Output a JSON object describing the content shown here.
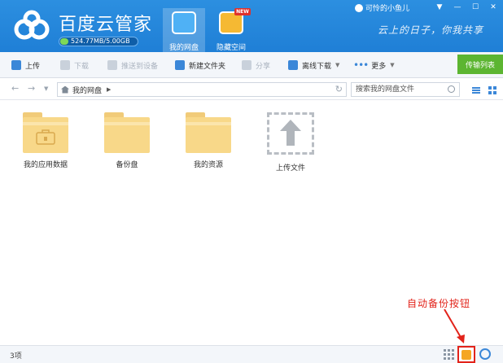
{
  "app": {
    "title": "百度云管家",
    "quota": "524.77MB/5.00GB",
    "user": "可怜的小鱼儿",
    "slogan": "云上的日子，你我共享"
  },
  "nav_tabs": [
    {
      "label": "我的网盘",
      "icon": "cloud-drive-icon",
      "active": true
    },
    {
      "label": "隐藏空间",
      "icon": "vault-lock-icon",
      "badge": "NEW"
    }
  ],
  "window_controls": [
    "▼",
    "—",
    "☐",
    "✕"
  ],
  "toolbar": {
    "upload": "上传",
    "download": "下载",
    "push": "推送到设备",
    "new_folder": "新建文件夹",
    "share": "分享",
    "offline": "离线下载",
    "more": "更多",
    "transfer": "传输列表"
  },
  "address": {
    "back": "←",
    "forward": "→",
    "path": "我的网盘",
    "search_placeholder": "搜索我的网盘文件"
  },
  "items": [
    {
      "label": "我的应用数据",
      "type": "folder-app"
    },
    {
      "label": "备份盘",
      "type": "folder"
    },
    {
      "label": "我的资源",
      "type": "folder"
    },
    {
      "label": "上传文件",
      "type": "upload"
    }
  ],
  "annotation": "自动备份按钮",
  "status": {
    "count": "3项"
  },
  "colors": {
    "header": "#2c8fe0",
    "accent_green": "#5cb531",
    "folder": "#f8d889",
    "annotation_red": "#e2231a"
  }
}
